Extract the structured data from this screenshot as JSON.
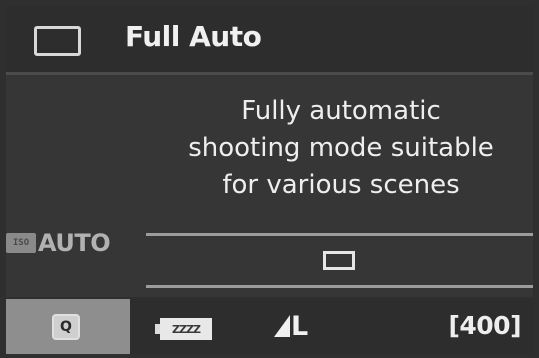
{
  "header": {
    "mode_icon": "rectangle-frame-icon",
    "title": "Full Auto"
  },
  "content": {
    "description_lines": [
      "Fully automatic",
      "shooting mode suitable",
      "for various scenes"
    ],
    "iso_icon": "iso-icon",
    "iso_value": "AUTO",
    "frame_icon": "rectangle-frame-icon"
  },
  "status_bar": {
    "q_button_label": "Q",
    "battery_icon": "battery-icon",
    "battery_text": "ZZZZ",
    "quality_icon": "quality-triangle-icon",
    "quality_text": "L",
    "shots_remaining": "[400]"
  },
  "colors": {
    "background": "#2f2f2f",
    "header": "#2d2d2d",
    "content": "#363636",
    "q_button": "#8e8e8e",
    "text": "#ececec",
    "divider": "#9c9c9c"
  }
}
